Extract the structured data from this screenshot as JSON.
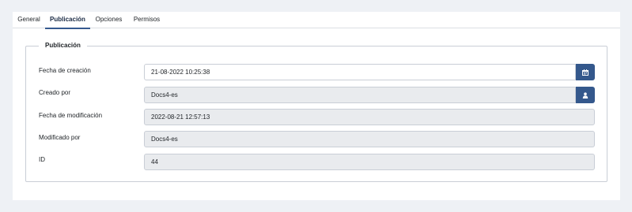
{
  "tabs": [
    {
      "label": "General"
    },
    {
      "label": "Publicación",
      "active": true
    },
    {
      "label": "Opciones"
    },
    {
      "label": "Permisos"
    }
  ],
  "fieldset": {
    "legend": "Publicación",
    "rows": [
      {
        "label": "Fecha de creación",
        "value": "21-08-2022 10:25:38",
        "readonly": false,
        "button_icon": "calendar-icon"
      },
      {
        "label": "Creado por",
        "value": "Docs4-es",
        "readonly": true,
        "button_icon": "user-icon"
      },
      {
        "label": "Fecha de modificación",
        "value": "2022-08-21 12:57:13",
        "readonly": true
      },
      {
        "label": "Modificado por",
        "value": "Docs4-es",
        "readonly": true
      },
      {
        "label": "ID",
        "value": "44",
        "readonly": true
      }
    ]
  },
  "colors": {
    "accent": "#34588c",
    "background": "#eef1f5",
    "readonly_field": "#e9ebee"
  }
}
